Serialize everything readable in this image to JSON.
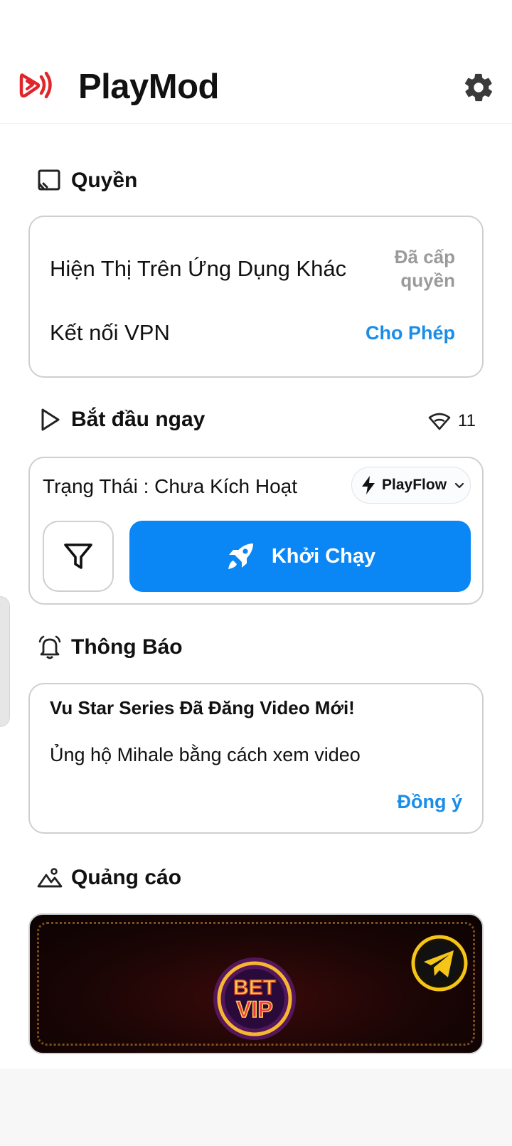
{
  "header": {
    "app_title": "PlayMod",
    "logo_icon": "playmod-logo-icon",
    "settings_icon": "gear-icon"
  },
  "permissions": {
    "section_title": "Quyền",
    "items": [
      {
        "label": "Hiện Thị Trên Ứng Dụng Khác",
        "status_line1": "Đã cấp",
        "status_line2": "quyền"
      },
      {
        "label": "Kết nối VPN",
        "action": "Cho Phép"
      }
    ]
  },
  "start": {
    "section_title": "Bắt đầu ngay",
    "server_count": "11",
    "status_label": "Trạng Thái :  Chưa Kích Hoạt",
    "flow_option": "PlayFlow",
    "run_label": "Khởi Chạy"
  },
  "notifications": {
    "section_title": "Thông Báo",
    "title": "Vu Star Series Đã Đăng Video Mới!",
    "body": "Ủng hộ Mihale bằng cách xem video",
    "action": "Đồng ý"
  },
  "ads": {
    "section_title": "Quảng cáo",
    "banner_logo_text": "BET VIP"
  },
  "colors": {
    "accent": "#0a87f5",
    "link": "#1a8de8",
    "brand_red": "#e0262b",
    "muted": "#9a9a9a"
  }
}
